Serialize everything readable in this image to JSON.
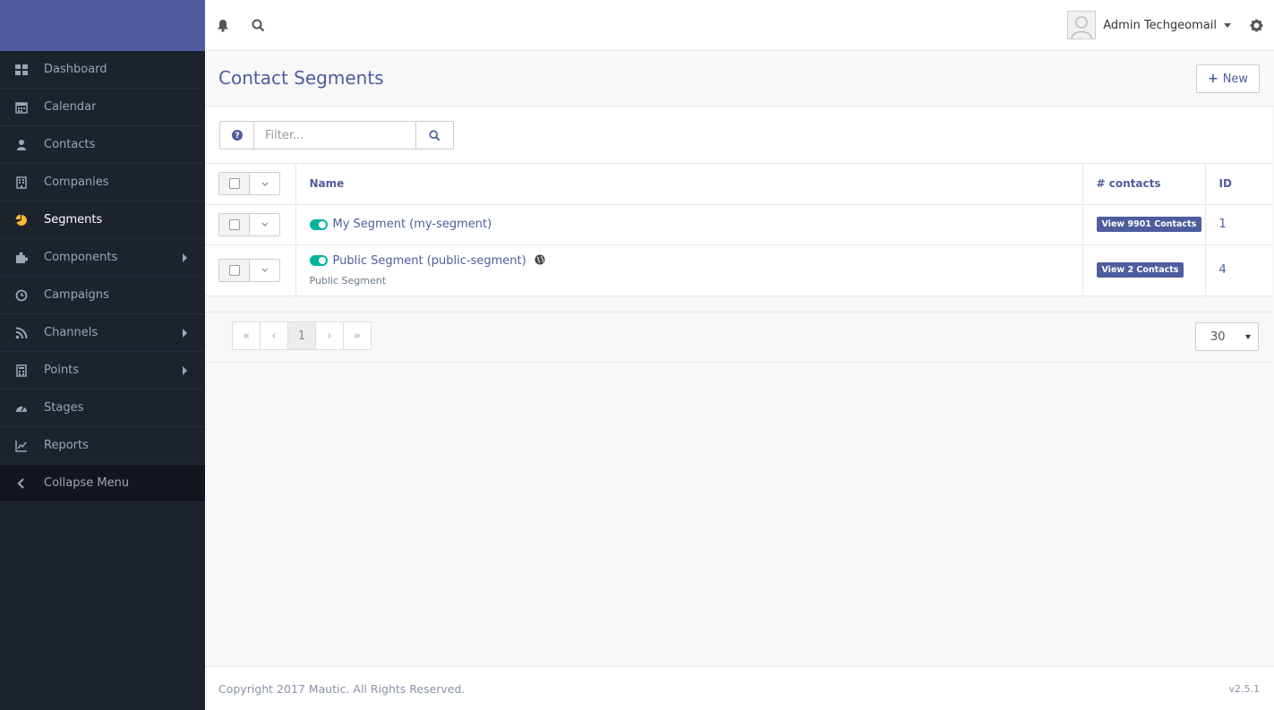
{
  "sidebar": {
    "items": [
      {
        "label": "Dashboard",
        "icon": "dashboard-icon"
      },
      {
        "label": "Calendar",
        "icon": "calendar-icon"
      },
      {
        "label": "Contacts",
        "icon": "user-icon"
      },
      {
        "label": "Companies",
        "icon": "building-icon"
      },
      {
        "label": "Segments",
        "icon": "pie-chart-icon",
        "active": true
      },
      {
        "label": "Components",
        "icon": "puzzle-icon",
        "has_children": true
      },
      {
        "label": "Campaigns",
        "icon": "clock-icon"
      },
      {
        "label": "Channels",
        "icon": "rss-icon",
        "has_children": true
      },
      {
        "label": "Points",
        "icon": "calculator-icon",
        "has_children": true
      },
      {
        "label": "Stages",
        "icon": "tachometer-icon"
      },
      {
        "label": "Reports",
        "icon": "line-chart-icon"
      }
    ],
    "collapse_label": "Collapse Menu"
  },
  "topbar": {
    "user_name": "Admin Techgeomail"
  },
  "page": {
    "title": "Contact Segments",
    "new_label": "New"
  },
  "filter": {
    "placeholder": "Filter..."
  },
  "table": {
    "headers": {
      "name": "Name",
      "contacts": "# contacts",
      "id": "ID"
    },
    "rows": [
      {
        "name": "My Segment (my-segment)",
        "subtitle": "",
        "contacts_label": "View 9901 Contacts",
        "id": "1",
        "public": false
      },
      {
        "name": "Public Segment (public-segment)",
        "subtitle": "Public Segment",
        "contacts_label": "View 2 Contacts",
        "id": "4",
        "public": true
      }
    ]
  },
  "pagination": {
    "current_page": "1",
    "limit": "30"
  },
  "footer": {
    "copyright": "Copyright 2017 Mautic. All Rights Reserved.",
    "version": "v2.5.1"
  },
  "colors": {
    "brand": "#4e5d9d",
    "sidebar_bg": "#1d232d",
    "toggle_on": "#00b49c",
    "active_icon": "#fdb933"
  }
}
